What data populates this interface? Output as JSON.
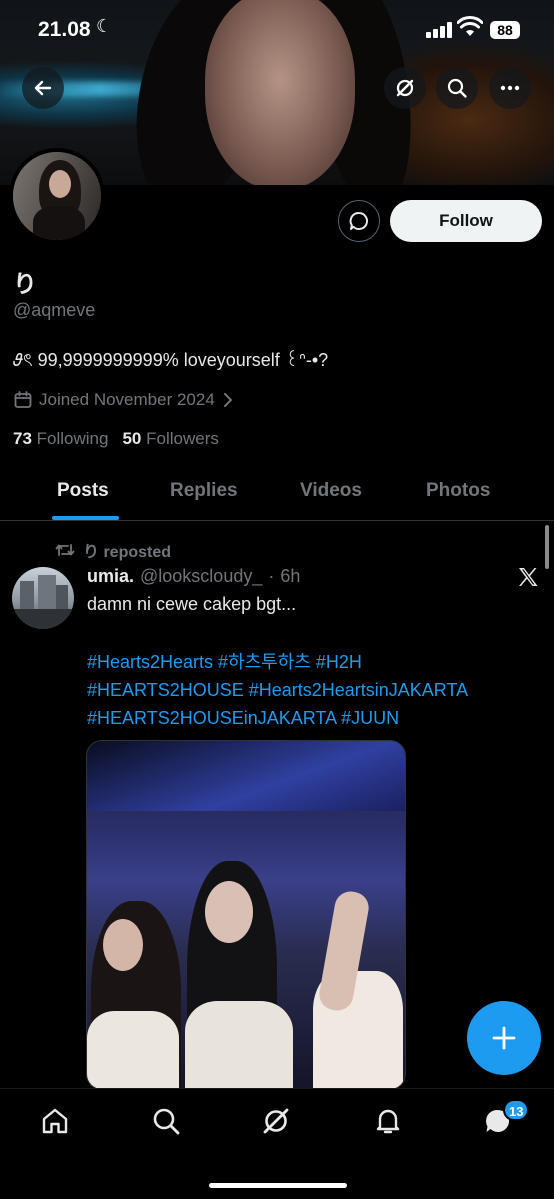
{
  "status_bar": {
    "time": "21.08",
    "battery": "88",
    "moon_icon": "moon-icon",
    "signal_icon": "cellular-signal-icon",
    "wifi_icon": "wifi-icon"
  },
  "banner": {
    "buttons": [
      "back-arrow-icon",
      "grok-icon",
      "search-icon",
      "more-dots-icon"
    ]
  },
  "profile": {
    "display_name": "り",
    "handle": "@aqmeve",
    "bio": "𝜗ৎ 99,9999999999% loveyourself ꒰ᐢ-•?",
    "joined": "Joined November 2024",
    "following_count": "73",
    "following_label": "Following",
    "followers_count": "50",
    "followers_label": "Followers",
    "follow_label": "Follow"
  },
  "tabs": [
    {
      "label": "Posts",
      "active": true
    },
    {
      "label": "Replies",
      "active": false
    },
    {
      "label": "Videos",
      "active": false
    },
    {
      "label": "Photos",
      "active": false
    }
  ],
  "post": {
    "repost_label": "り reposted",
    "author_name": "umia.",
    "author_handle": "@lookscloudy_",
    "separator": "·",
    "time": "6h",
    "text": "damn ni cewe cakep bgt...",
    "hashtags_line1": "#Hearts2Hearts #하츠투하츠 #H2H",
    "hashtags_line2": "#HEARTS2HOUSE #Hearts2HeartsinJAKARTA",
    "hashtags_line3": "#HEARTS2HOUSEinJAKARTA #JUUN"
  },
  "bottom_nav": {
    "items": [
      "home-icon",
      "search-icon",
      "grok-icon",
      "notifications-bell-icon",
      "messages-icon"
    ],
    "messages_badge": "13"
  },
  "colors": {
    "accent": "#1d9bf0",
    "background": "#000000",
    "text_primary": "#e7e9ea",
    "text_secondary": "#71767b"
  }
}
